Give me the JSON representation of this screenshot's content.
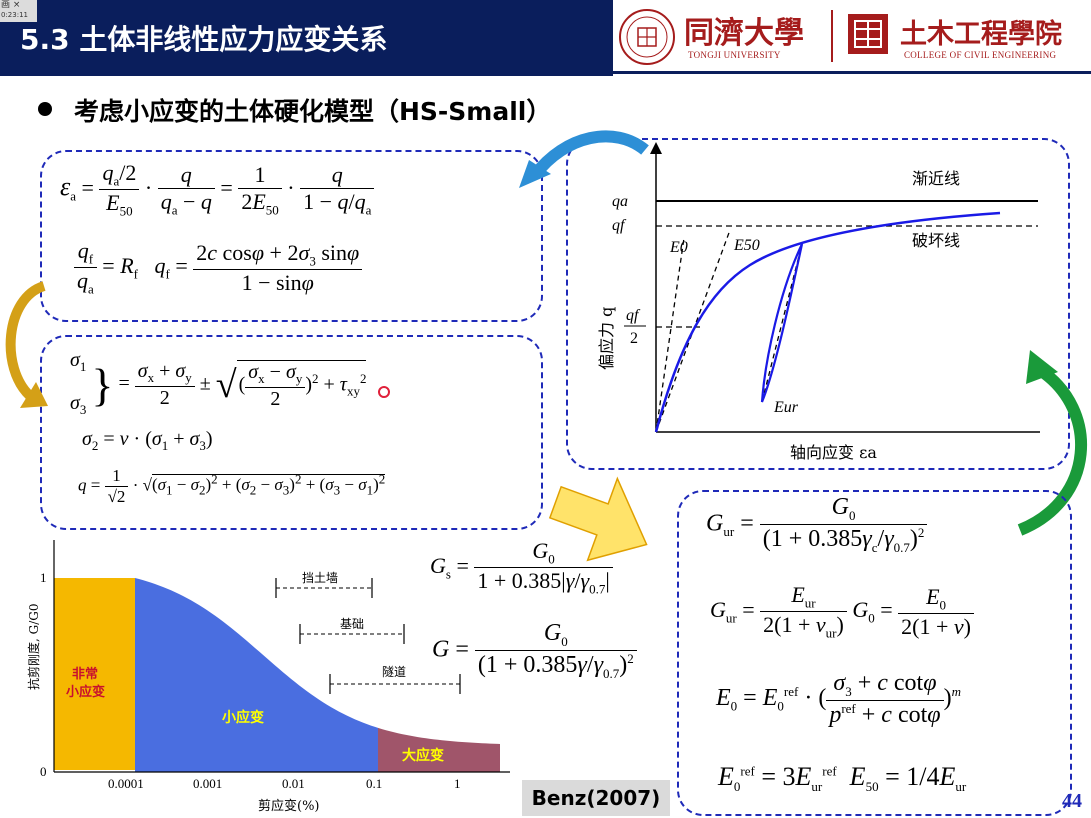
{
  "header": {
    "title": "5.3 土体非线性应力应变关系",
    "corner_tag": "画 ×",
    "corner_time": "0:23:11",
    "university_cn": "同濟大學",
    "university_en": "TONGJI UNIVERSITY",
    "college_cn": "土木工程學院",
    "college_en": "COLLEGE OF CIVIL ENGINEERING"
  },
  "bullet": {
    "text": "考虑小应变的土体硬化模型（HS-Small）"
  },
  "curve_plot": {
    "y_axis_label": "偏应力 q",
    "x_axis_label": "轴向应变 εa",
    "asymptote_label": "渐近线",
    "failure_label": "破坏线",
    "qa_label": "qa",
    "qf_label": "qf",
    "qf2_num": "qf",
    "qf2_den": "2",
    "E0_label": "E0",
    "E50_label": "E50",
    "Eur_label": "Eur"
  },
  "stiffness_plot": {
    "y_axis_label": "抗剪刚度, G/G0",
    "x_axis_label": "剪应变(%)",
    "y_ticks": [
      "1",
      "0"
    ],
    "x_ticks": [
      "0.0001",
      "0.001",
      "0.01",
      "0.1",
      "1"
    ],
    "region_very_small_line1": "非常",
    "region_very_small_line2": "小应变",
    "region_small": "小应变",
    "region_large": "大应变",
    "range_retaining_wall": "挡土墙",
    "range_foundation": "基础",
    "range_tunnel": "隧道",
    "colors": {
      "very_small": "#f5b800",
      "small": "#4a6ee0",
      "large": "#a0556a"
    }
  },
  "citation": "Benz(2007)",
  "page_number": "44"
}
